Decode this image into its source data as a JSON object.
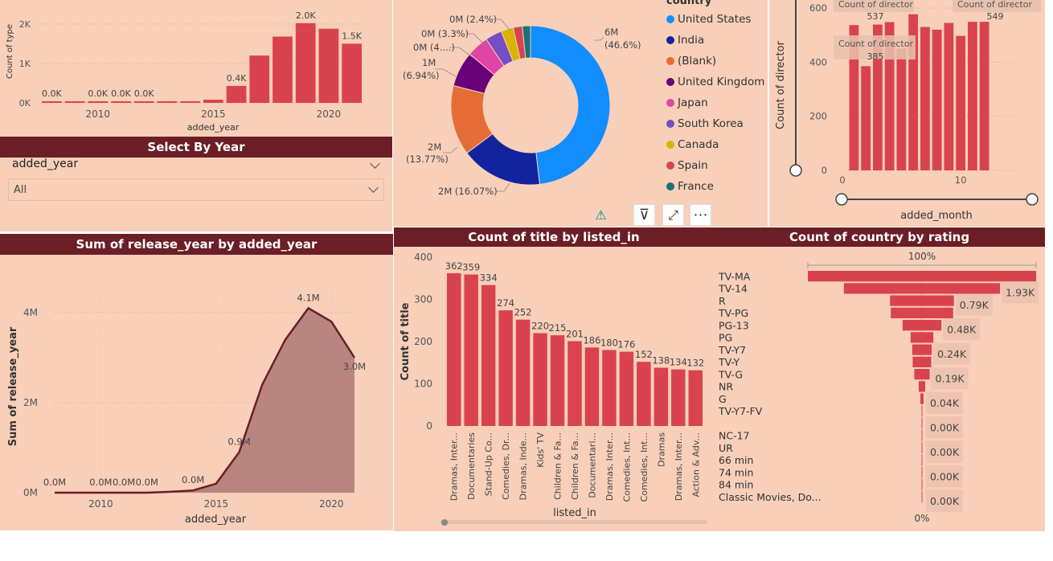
{
  "colors": {
    "accent": "#d9434e",
    "header": "#6b1e26",
    "panel": "#f8cfb9",
    "area": "#b98580"
  },
  "type_chart": {
    "ylabel": "Count of type",
    "xlabel": "added_year",
    "yticks": [
      "2K",
      "1K",
      "0K"
    ],
    "xticks": [
      "2010",
      "2015",
      "2020"
    ],
    "labels": [
      "0.0K",
      "0.0K",
      "0.0K",
      "0.0K",
      "0.4K",
      "2.0K",
      "1.5K"
    ]
  },
  "year_slicer": {
    "title": "Select By Year",
    "field": "added_year",
    "value": "All"
  },
  "release_chart": {
    "title": "Sum of release_year by added_year",
    "ylabel": "Sum of release_year",
    "xlabel": "added_year",
    "yticks": [
      "4M",
      "2M",
      "0M"
    ],
    "xticks": [
      "2010",
      "2015",
      "2020"
    ],
    "labels": [
      "0.0M",
      "0.0M",
      "0.0M",
      "0.0M",
      "0.0M",
      "0.9M",
      "4.1M",
      "3.0M"
    ]
  },
  "donut": {
    "legend_title": "country",
    "legend": [
      {
        "name": "United States",
        "color": "#118dff"
      },
      {
        "name": "India",
        "color": "#12239e"
      },
      {
        "name": "(Blank)",
        "color": "#e66c37"
      },
      {
        "name": "United Kingdom",
        "color": "#6b007b"
      },
      {
        "name": "Japan",
        "color": "#e044a7"
      },
      {
        "name": "South Korea",
        "color": "#744ec2"
      },
      {
        "name": "Canada",
        "color": "#d9b300"
      },
      {
        "name": "Spain",
        "color": "#d64550"
      },
      {
        "name": "France",
        "color": "#197278"
      }
    ],
    "labels": {
      "us_a": "6M",
      "us_b": "(46.6%)",
      "india": "2M (16.07%)",
      "blank_a": "2M",
      "blank_b": "(13.77%)",
      "uk_a": "1M",
      "uk_b": "(6.94%)",
      "jp": "0M (4....)",
      "kr": "0M (3.3%)",
      "ca": "0M (2.4%)"
    },
    "toolbar": {
      "warning": "⚠",
      "filter": "⊽",
      "focus": "⤢",
      "more": "⋯"
    }
  },
  "director_chart": {
    "ylabel": "Count of director",
    "xlabel": "added_month",
    "yticks": [
      "600",
      "400",
      "200",
      "0"
    ],
    "xticks": [
      "0",
      "10"
    ],
    "tooltips": [
      {
        "label": "Count of director",
        "value": "537"
      },
      {
        "label": "Count of director",
        "value": "549"
      },
      {
        "label": "Count of director",
        "value": "385"
      }
    ]
  },
  "listed_chart": {
    "title": "Count of title by listed_in",
    "ylabel": "Count of title",
    "xlabel": "listed_in",
    "yticks": [
      "400",
      "300",
      "200",
      "100",
      "0"
    ]
  },
  "rating_chart": {
    "title": "Count of country by rating",
    "top": "100%",
    "bottom": "0%",
    "rows": [
      {
        "rating": "TV-MA",
        "label": ""
      },
      {
        "rating": "TV-14",
        "label": "1.93K"
      },
      {
        "rating": "R",
        "label": "0.79K"
      },
      {
        "rating": "TV-PG",
        "label": ""
      },
      {
        "rating": "PG-13",
        "label": "0.48K"
      },
      {
        "rating": "PG",
        "label": ""
      },
      {
        "rating": "TV-Y7",
        "label": "0.24K"
      },
      {
        "rating": "TV-Y",
        "label": ""
      },
      {
        "rating": "TV-G",
        "label": "0.19K"
      },
      {
        "rating": "NR",
        "label": ""
      },
      {
        "rating": "G",
        "label": "0.04K"
      },
      {
        "rating": "TV-Y7-FV",
        "label": ""
      },
      {
        "rating": "",
        "label": "0.00K"
      },
      {
        "rating": "NC-17",
        "label": ""
      },
      {
        "rating": "UR",
        "label": "0.00K"
      },
      {
        "rating": "66 min",
        "label": ""
      },
      {
        "rating": "74 min",
        "label": "0.00K"
      },
      {
        "rating": "84 min",
        "label": ""
      },
      {
        "rating": "Classic Movies, Do...",
        "label": "0.00K"
      }
    ]
  },
  "chart_data": [
    {
      "type": "bar",
      "title": "",
      "xlabel": "added_year",
      "ylabel": "Count of type",
      "x": [
        2008,
        2009,
        2010,
        2011,
        2012,
        2013,
        2014,
        2015,
        2016,
        2017,
        2018,
        2019,
        2020,
        2021
      ],
      "values": [
        0,
        0,
        0,
        0,
        0,
        0,
        10,
        80,
        430,
        1200,
        1680,
        2020,
        1880,
        1500
      ],
      "ylim": [
        0,
        2200
      ]
    },
    {
      "type": "area",
      "title": "Sum of release_year by added_year",
      "xlabel": "added_year",
      "ylabel": "Sum of release_year",
      "x": [
        2008,
        2009,
        2010,
        2011,
        2012,
        2013,
        2014,
        2015,
        2016,
        2017,
        2018,
        2019,
        2020,
        2021
      ],
      "values": [
        0,
        0,
        0,
        0,
        0,
        0.02,
        0.05,
        0.2,
        0.9,
        2.4,
        3.4,
        4.1,
        3.8,
        3.0
      ],
      "ylim": [
        0,
        4.5
      ]
    },
    {
      "type": "pie",
      "title": "",
      "legend_title": "country",
      "categories": [
        "United States",
        "India",
        "(Blank)",
        "United Kingdom",
        "Japan",
        "South Korea",
        "Canada",
        "Spain",
        "France"
      ],
      "values": [
        46.6,
        16.07,
        13.77,
        6.94,
        4.3,
        3.3,
        2.4,
        1.8,
        1.6
      ]
    },
    {
      "type": "bar",
      "title": "",
      "xlabel": "added_month",
      "ylabel": "Count of director",
      "x": [
        1,
        2,
        3,
        4,
        5,
        6,
        7,
        8,
        9,
        10,
        11,
        12
      ],
      "values": [
        537,
        385,
        539,
        548,
        450,
        577,
        530,
        520,
        545,
        497,
        549,
        549
      ],
      "ylim": [
        0,
        640
      ]
    },
    {
      "type": "bar",
      "title": "Count of title by listed_in",
      "xlabel": "listed_in",
      "ylabel": "Count of title",
      "categories": [
        "Dramas, Inter...",
        "Documentaries",
        "Stand-Up Co...",
        "Comedies, Dr...",
        "Dramas, Inde...",
        "Kids' TV",
        "Children & Fa...",
        "Children & Fa...",
        "Documentari...",
        "Dramas, Inter...",
        "Comedies, Int...",
        "Comedies, Int...",
        "Dramas",
        "Dramas, Inter...",
        "Action & Adv..."
      ],
      "values": [
        362,
        359,
        334,
        274,
        252,
        220,
        215,
        201,
        186,
        180,
        176,
        152,
        138,
        134,
        132
      ],
      "ylim": [
        0,
        400
      ]
    },
    {
      "type": "bar",
      "title": "Count of country by rating",
      "categories": [
        "TV-MA",
        "TV-14",
        "R",
        "TV-PG",
        "PG-13",
        "PG",
        "TV-Y7",
        "TV-Y",
        "TV-G",
        "NR",
        "G",
        "TV-Y7-FV",
        "",
        "NC-17",
        "UR",
        "66 min",
        "74 min",
        "84 min",
        "Classic Movies, Do..."
      ],
      "values": [
        2820,
        1930,
        790,
        770,
        480,
        280,
        240,
        230,
        190,
        80,
        40,
        6,
        3,
        3,
        3,
        1,
        1,
        1,
        1
      ]
    }
  ]
}
